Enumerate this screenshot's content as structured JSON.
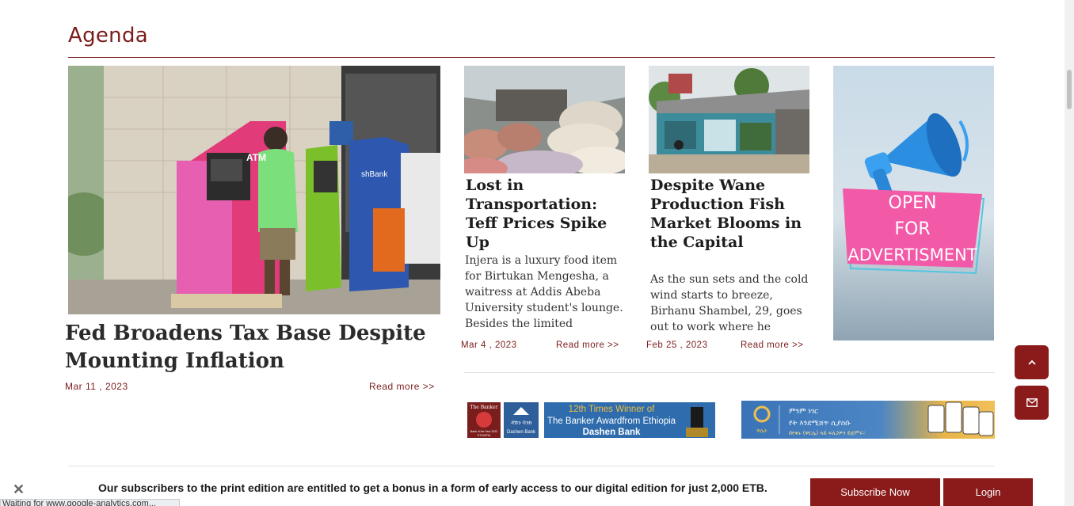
{
  "section": {
    "title": "Agenda"
  },
  "feature": {
    "title": "Fed Broadens Tax Base Despite Mounting Inflation",
    "date": "Mar 11 , 2023",
    "read_more": "Read more >>",
    "atm_sign": "ATM",
    "atm_brand": "shBank"
  },
  "cards": [
    {
      "title": "Lost in Transportation: Teff Prices Spike Up",
      "excerpt": "Injera is a luxury food item for Birtukan Mengesha, a waitress at Addis Abeba University student's lounge. Besides the limited",
      "date": "Mar 4 , 2023",
      "read_more": "Read more >>"
    },
    {
      "title": "Despite Wane Production Fish Market Blooms in the Capital",
      "excerpt": "As the sun sets and the cold wind starts to breeze, Birhanu Shambel, 29, goes out to work where he",
      "date": "Feb 25 , 2023",
      "read_more": "Read more >>"
    }
  ],
  "advert": {
    "line1": "OPEN",
    "line2": "FOR",
    "line3": "ADVERTISMENT"
  },
  "banners": {
    "dashen": {
      "badge_top": "The Banker",
      "badge_sub": "Bank of the Year 2022",
      "badge_country": "ETHIOPIA",
      "logo_amharic": "ዳሽን ባንክ",
      "logo_english": "Dashen Bank",
      "line1": "12th Times Winner of",
      "line2": "The Banker Awardfrom Ethiopia",
      "line3": "Dashen Bank"
    },
    "app": {
      "logo": "ዋሌት",
      "line1": "ምንም ነገር",
      "line2": "የት እንደሚሸጥ ሲያስቡ",
      "line3": "በየቀኑ (ዋርሌ) ላይ ፍለጋዎን ይጀምሩ።"
    }
  },
  "subscribe": {
    "close": "✕",
    "text": "Our subscribers to the print edition are entitled to get a bonus in a form of early access to our digital edition for just 2,000 ETB.",
    "subscribe_label": "Subscribe Now",
    "login_label": "Login"
  },
  "status": {
    "text": "Waiting for www.google-analytics.com..."
  },
  "icons": {
    "scroll_up": "chevron-up-icon",
    "mail": "envelope-icon"
  },
  "colors": {
    "accent": "#8b1a1a",
    "heading": "#7a1c1c"
  }
}
